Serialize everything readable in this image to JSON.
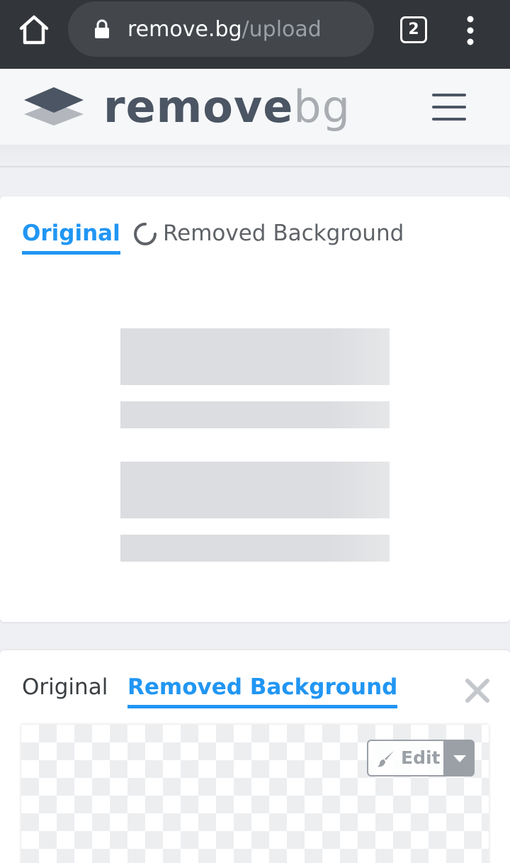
{
  "browser": {
    "url_host": "remove.bg",
    "url_path": "/upload",
    "tab_count": "2",
    "icons": [
      "home-icon",
      "lock-icon",
      "more-vert-icon"
    ]
  },
  "header": {
    "logo_word1": "remove",
    "logo_word2": "bg",
    "icons": [
      "logo-layers-icon",
      "hamburger-menu-icon"
    ]
  },
  "card_original": {
    "tabs": [
      {
        "label": "Original",
        "active": true
      },
      {
        "label": "Removed Background",
        "active": false,
        "loading": true
      }
    ]
  },
  "card_result": {
    "tabs": [
      {
        "label": "Original",
        "active": false
      },
      {
        "label": "Removed Background",
        "active": true
      }
    ],
    "edit_label": "Edit",
    "icons": [
      "close-icon",
      "brush-icon",
      "caret-down-icon"
    ]
  },
  "colors": {
    "accent": "#2196f3",
    "browser_bar": "#323539",
    "text_gray": "#5f6368",
    "logo_dark": "#4b5563",
    "logo_light": "#a9adb2"
  }
}
